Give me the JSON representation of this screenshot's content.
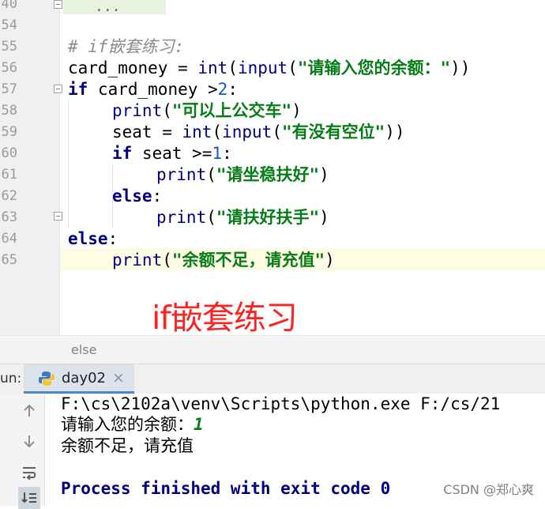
{
  "editor": {
    "line_numbers": [
      "40",
      "54",
      "55",
      "56",
      "57",
      "58",
      "59",
      "60",
      "61",
      "62",
      "63",
      "64",
      "65"
    ],
    "folded_placeholder": "...",
    "lines": {
      "comment": "# if嵌套练习:",
      "l56_var": "card_money = ",
      "l56_int": "int",
      "l56_p1": "(",
      "l56_input": "input",
      "l56_p2": "(",
      "l56_str": "\"请输入您的余额：\"",
      "l56_p3": "))",
      "l57_kw": "if",
      "l57_mid": " card_money >",
      "l57_num": "2",
      "l57_end": ":",
      "l58_print": "print",
      "l58_p1": "(",
      "l58_str": "\"可以上公交车\"",
      "l58_p2": ")",
      "l59_var": "seat = ",
      "l59_int": "int",
      "l59_p1": "(",
      "l59_input": "input",
      "l59_p2": "(",
      "l59_str": "\"有没有空位\"",
      "l59_p3": "))",
      "l60_kw": "if",
      "l60_mid": " seat >=",
      "l60_num": "1",
      "l60_end": ":",
      "l61_print": "print",
      "l61_p1": "(",
      "l61_str": "\"请坐稳扶好\"",
      "l61_p2": ")",
      "l62_kw": "else",
      "l62_end": ":",
      "l63_print": "print",
      "l63_p1": "(",
      "l63_str": "\"请扶好扶手\"",
      "l63_p2": ")",
      "l64_kw": "else",
      "l64_end": ":",
      "l65_print": "print",
      "l65_p1": "(",
      "l65_str": "\"余额不足，请充值\"",
      "l65_p2": ")"
    },
    "annotation": "if嵌套练习"
  },
  "breadcrumb": "else",
  "run_panel": {
    "label": "un:",
    "tab_name": "day02",
    "tab_close": "×",
    "console": {
      "command": "F:\\cs\\2102a\\venv\\Scripts\\python.exe F:/cs/21",
      "prompt": "请输入您的余额：",
      "input": "1",
      "output": "余额不足，请充值",
      "exit": "Process finished with exit code 0"
    }
  },
  "watermark": "CSDN @郑心爽",
  "icons": [
    "arrow-up-icon",
    "arrow-down-icon",
    "soft-wrap-icon",
    "scroll-to-end-icon",
    "python-icon",
    "close-icon"
  ],
  "colors": {
    "keyword": "#000080",
    "string": "#067d17",
    "number": "#1750eb",
    "comment": "#8c8c8c",
    "annotation": "#ff2222",
    "highlight_line": "#fffce6"
  }
}
